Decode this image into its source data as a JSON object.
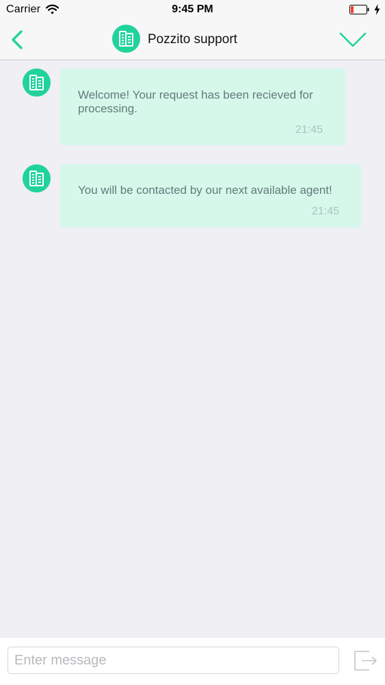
{
  "status_bar": {
    "carrier": "Carrier",
    "time": "9:45 PM"
  },
  "nav": {
    "title": "Pozzito support",
    "accent_color": "#21d39b",
    "icons": {
      "back": "chevron-left-icon",
      "avatar": "building-icon",
      "done": "checkmark-icon"
    }
  },
  "messages": [
    {
      "text": "Welcome! Your request has been recieved for processing.",
      "time": "21:45",
      "avatar_icon": "building-icon"
    },
    {
      "text": "You will be contacted by our next available agent!",
      "time": "21:45",
      "avatar_icon": "building-icon"
    }
  ],
  "composer": {
    "placeholder": "Enter message",
    "value": "",
    "send_icon": "send-exit-icon"
  },
  "colors": {
    "background": "#efeff4",
    "bubble": "#d5f8ea",
    "bubble_text": "#65797c",
    "timestamp": "#a9c3c0"
  }
}
